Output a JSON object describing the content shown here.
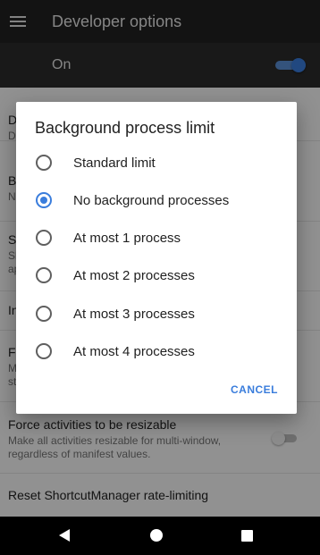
{
  "appbar": {
    "title": "Developer options",
    "icon": "menu-icon"
  },
  "master_switch": {
    "label": "On",
    "state": "on"
  },
  "settings": [
    {
      "title": "D",
      "summary": "D"
    },
    {
      "title": "B",
      "summary": "N"
    },
    {
      "title": "S",
      "summary": "Sl\nap"
    },
    {
      "title": "In",
      "summary": ""
    },
    {
      "title": "Fo",
      "summary": "M\nst"
    },
    {
      "title": "Force activities to be resizable",
      "summary": "Make all activities resizable for multi-window,\nregardless of manifest values.",
      "toggle": "off"
    },
    {
      "title": "Reset ShortcutManager rate-limiting",
      "summary": ""
    }
  ],
  "dialog": {
    "title": "Background process limit",
    "options": [
      {
        "label": "Standard limit",
        "selected": false
      },
      {
        "label": "No background processes",
        "selected": true
      },
      {
        "label": "At most 1 process",
        "selected": false
      },
      {
        "label": "At most 2 processes",
        "selected": false
      },
      {
        "label": "At most 3 processes",
        "selected": false
      },
      {
        "label": "At most 4 processes",
        "selected": false
      }
    ],
    "cancel_label": "CANCEL"
  },
  "navbar": {
    "back": "back-icon",
    "home": "home-icon",
    "recents": "recents-icon"
  },
  "colors": {
    "accent": "#3a7ddc",
    "appbar": "#212121"
  }
}
